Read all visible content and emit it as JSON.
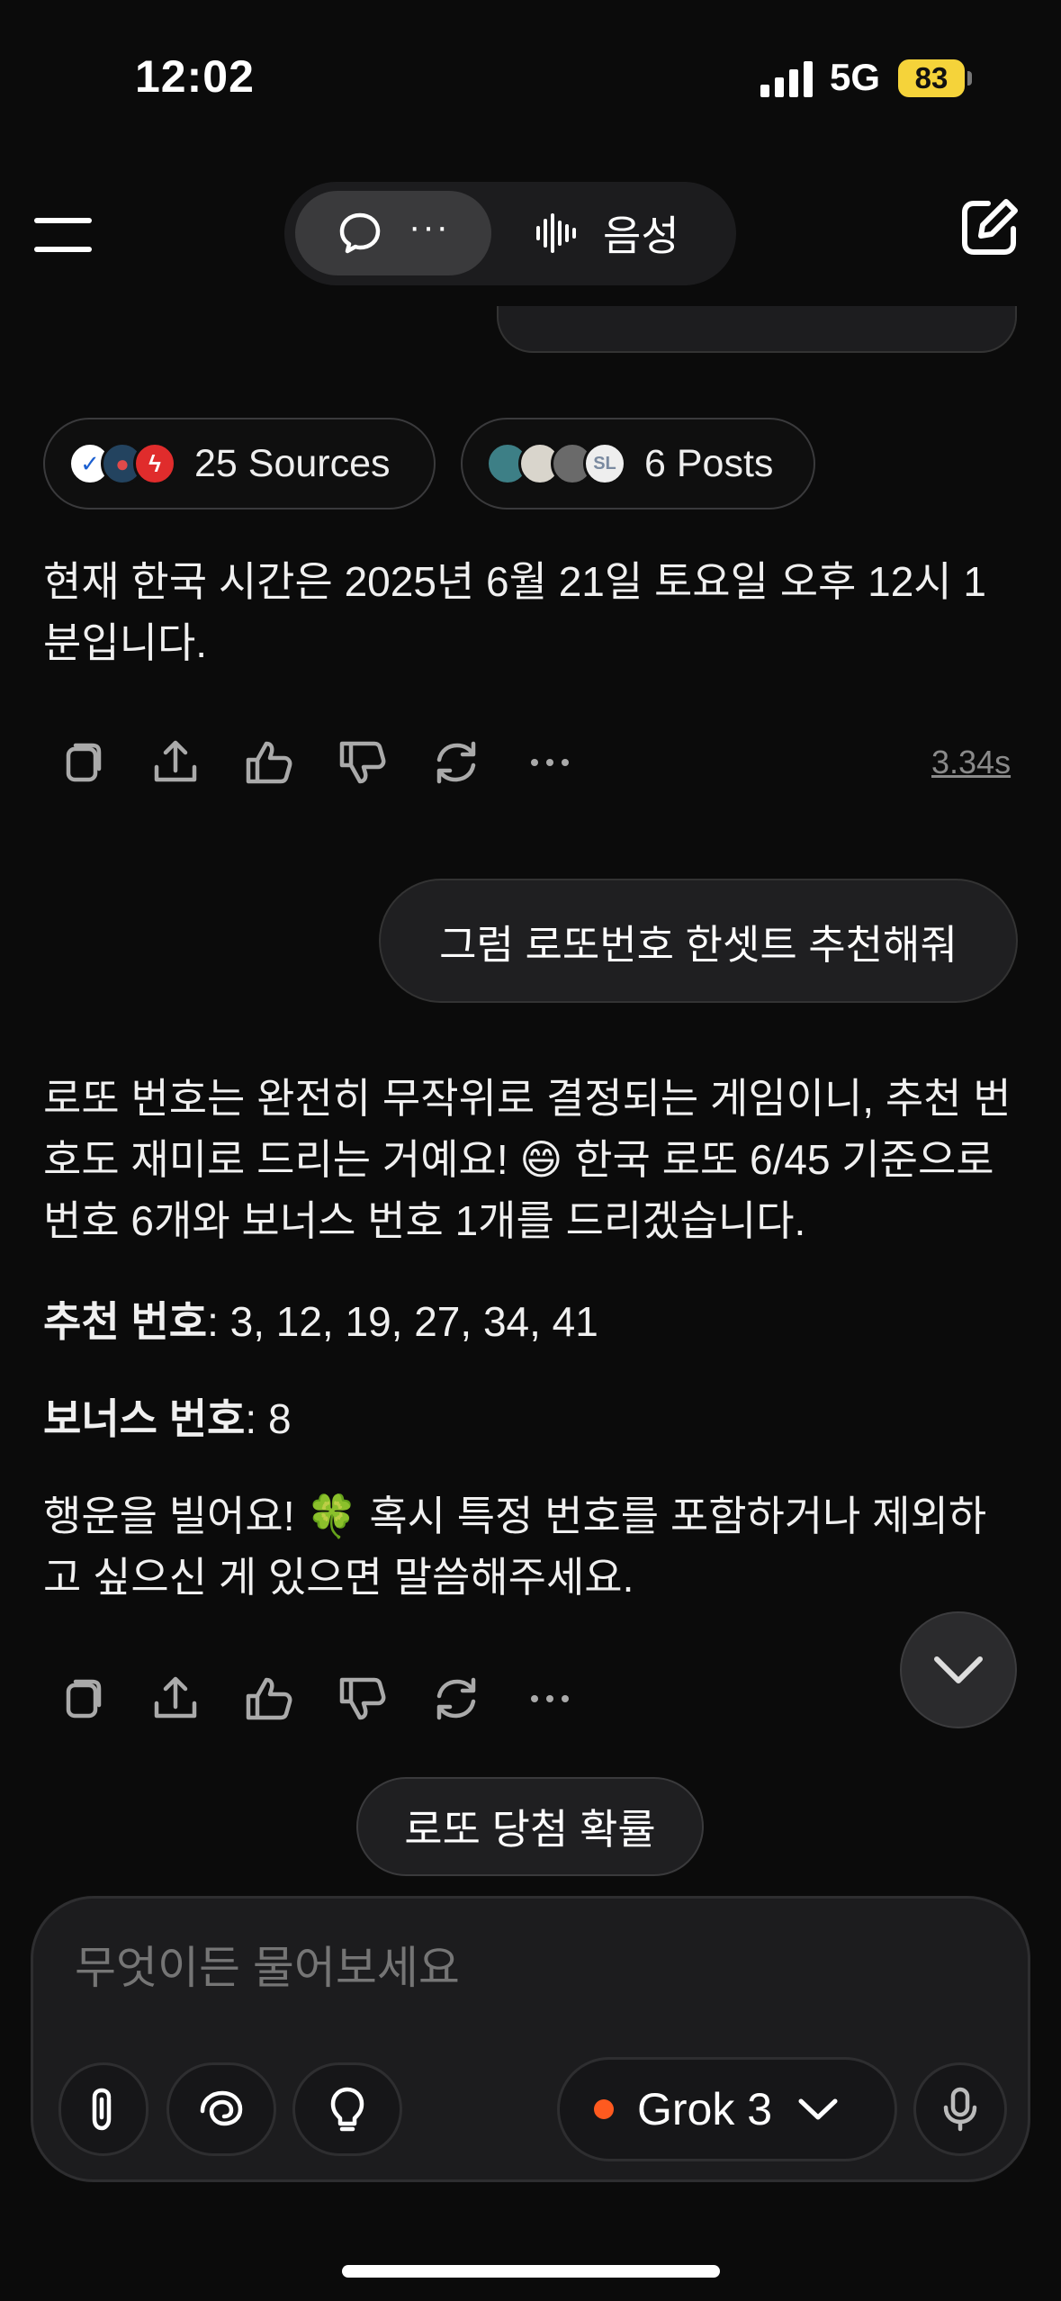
{
  "status_bar": {
    "time": "12:02",
    "network": "5G",
    "battery": "83"
  },
  "nav": {
    "chat_mode_dots": "···",
    "voice_label": "음성"
  },
  "sources": {
    "sources_label": "25 Sources",
    "posts_label": "6 Posts"
  },
  "messages": {
    "answer1": "현재 한국 시간은 2025년 6월 21일 토요일 오후 12시 1분입니다.",
    "answer1_time": "3.34s",
    "user2": "그럼 로또번호 한셋트 추천해줘",
    "answer2_p1": "로또 번호는 완전히 무작위로 결정되는 게임이니, 추천 번호도 재미로 드리는 거예요! 😄 한국 로또 6/45 기준으로 번호 6개와 보너스 번호 1개를 드리겠습니다.",
    "rec_label": "추천 번호",
    "rec_value": ": 3, 12, 19, 27, 34, 41",
    "bonus_label": "보너스 번호",
    "bonus_value": ": 8",
    "answer2_p4": "행운을 빌어요! 🍀 혹시 특정 번호를 포함하거나 제외하고 싶으신 게 있으면 말씀해주세요."
  },
  "suggestion": "로또 당첨 확률",
  "composer": {
    "placeholder": "무엇이든 물어보세요",
    "model": "Grok 3"
  },
  "colors": {
    "background": "#0b0b0b",
    "bubble": "#1f1f21",
    "battery": "#f5d33a",
    "model_dot": "#ff5a1f"
  }
}
